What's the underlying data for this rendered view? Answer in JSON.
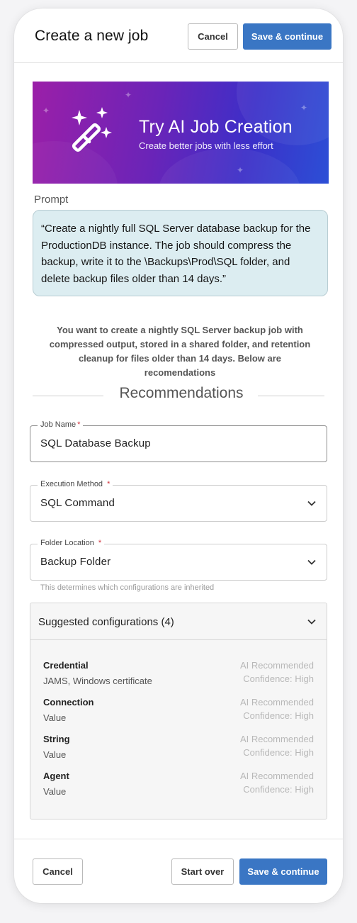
{
  "header": {
    "title": "Create a new job",
    "cancel_label": "Cancel",
    "save_label": "Save & continue"
  },
  "banner": {
    "title": "Try AI Job Creation",
    "subtitle": "Create better jobs with less effort",
    "icon": "magic-wand-icon",
    "gradient_start": "#9b1fa8",
    "gradient_end": "#2c4fd6"
  },
  "prompt": {
    "label": "Prompt",
    "text": "“Create a nightly full SQL Server database backup for the ProductionDB instance. The job should compress the backup, write it to the \\Backups\\Prod\\SQL folder, and delete backup files older than 14 days.”"
  },
  "summary": "You want to create a nightly SQL Server backup job with compressed output, stored in a shared folder, and retention cleanup for files older than 14 days. Below are recomendations",
  "recommendations": {
    "title": "Recommendations",
    "job_name": {
      "label": "Job Name",
      "required_mark": "*",
      "value": "SQL Database Backup"
    },
    "execution_method": {
      "label": "Execution Method",
      "required_mark": "*",
      "value": "SQL Command"
    },
    "folder_location": {
      "label": "Folder Location",
      "required_mark": "*",
      "value": "Backup Folder",
      "helper": "This determines which configurations are inherited"
    }
  },
  "suggested": {
    "title": "Suggested configurations (4)",
    "items": [
      {
        "name": "Credential",
        "value": "JAMS, Windows certificate",
        "recommendation": "AI Recommended",
        "confidence": "Confidence: High"
      },
      {
        "name": "Connection",
        "value": "Value",
        "recommendation": "AI Recommended",
        "confidence": "Confidence: High"
      },
      {
        "name": "String",
        "value": "Value",
        "recommendation": "AI Recommended",
        "confidence": "Confidence: High"
      },
      {
        "name": "Agent",
        "value": "Value",
        "recommendation": "AI Recommended",
        "confidence": "Confidence: High"
      }
    ]
  },
  "footer": {
    "cancel_label": "Cancel",
    "start_over_label": "Start over",
    "save_label": "Save & continue"
  },
  "colors": {
    "primary": "#3a76c4",
    "prompt_bg": "#dcedf1",
    "required": "#d0313b"
  }
}
